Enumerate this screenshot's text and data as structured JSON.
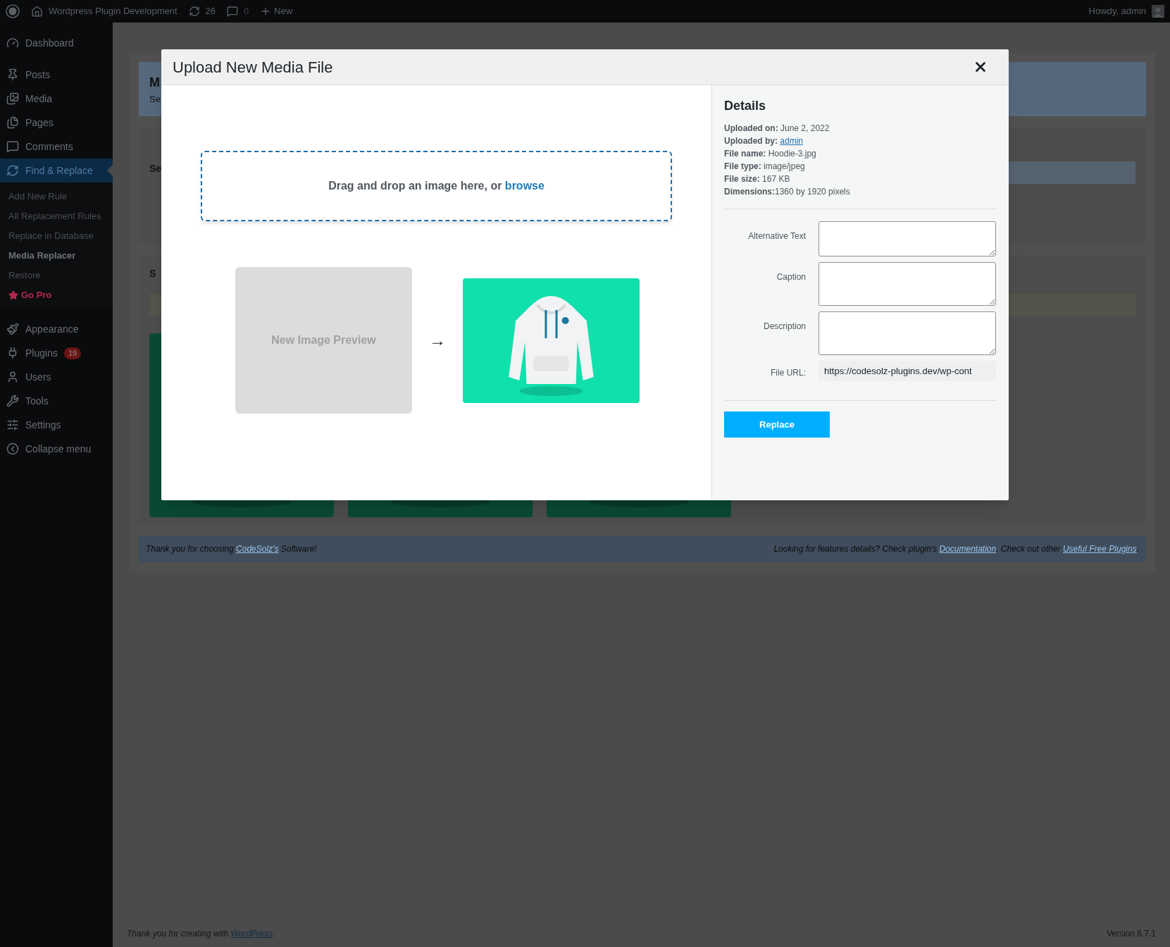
{
  "admin_bar": {
    "site_title": "Wordpress Plugin Development",
    "updates_count": "26",
    "comments_count": "0",
    "new_label": "New",
    "greeting": "Howdy, admin"
  },
  "sidebar": {
    "items": [
      {
        "label": "Dashboard",
        "selected": false
      },
      {
        "label": "Posts",
        "selected": false
      },
      {
        "label": "Media",
        "selected": false
      },
      {
        "label": "Pages",
        "selected": false
      },
      {
        "label": "Comments",
        "selected": false
      },
      {
        "label": "Find & Replace",
        "selected": true,
        "children": [
          {
            "label": "Add New Rule",
            "selected": false,
            "kind": "link"
          },
          {
            "label": "All Replacement Rules",
            "selected": false,
            "kind": "link"
          },
          {
            "label": "Replace in Database",
            "selected": false,
            "kind": "link"
          },
          {
            "label": "Media Replacer",
            "selected": true,
            "kind": "link"
          },
          {
            "label": "Restore",
            "selected": false,
            "kind": "link"
          },
          {
            "label": "Go Pro",
            "selected": false,
            "kind": "promo"
          }
        ]
      },
      {
        "label": "Appearance",
        "selected": false
      },
      {
        "label": "Plugins",
        "selected": false,
        "badge": "19"
      },
      {
        "label": "Users",
        "selected": false
      },
      {
        "label": "Tools",
        "selected": false
      },
      {
        "label": "Settings",
        "selected": false
      },
      {
        "label": "Collapse menu",
        "selected": false
      }
    ]
  },
  "page": {
    "title": "M",
    "subtitle": "Se",
    "section_1_label": "Se",
    "section_2_label": "S"
  },
  "footer_bar": {
    "left_before": "Thank you for choosing",
    "left_link": "CodeSolz's",
    "left_after": "Software!",
    "right_before": "Looking for features details? Check plugin's",
    "right_link_1": "Documentation",
    "right_middle": ". Check out other",
    "right_link_2": "Useful Free Plugins",
    "right_after": "."
  },
  "page_footer": {
    "before": "Thank you for creating with",
    "link": "WordPress",
    "after": ".",
    "version": "Version 6.7.1"
  },
  "modal": {
    "title": "Upload New Media File",
    "dropzone_text": "Drag and drop an image here, or",
    "browse_link": "browse",
    "preview_placeholder": "New Image Preview",
    "arrow": "→",
    "details": {
      "heading": "Details",
      "meta": [
        {
          "label": "Uploaded on:",
          "value": "June 2, 2022",
          "kind": "text"
        },
        {
          "label": "Uploaded by:",
          "value": "admin",
          "kind": "link"
        },
        {
          "label": "File name:",
          "value": "Hoodie-3.jpg",
          "kind": "text"
        },
        {
          "label": "File type:",
          "value": "image/jpeg",
          "kind": "text"
        },
        {
          "label": "File size:",
          "value": "167 KB",
          "kind": "text"
        },
        {
          "label": "Dimensions:",
          "value": "1360 by 1920 pixels",
          "kind": "text"
        }
      ],
      "fields": [
        {
          "label": "Alternative Text",
          "kind": "textarea"
        },
        {
          "label": "Caption",
          "kind": "textarea"
        },
        {
          "label": "Description",
          "kind": "textarea"
        },
        {
          "label": "File URL:",
          "kind": "readonly",
          "value": "https://codesolz-plugins.dev/wp-cont"
        }
      ],
      "button": "Replace"
    }
  }
}
